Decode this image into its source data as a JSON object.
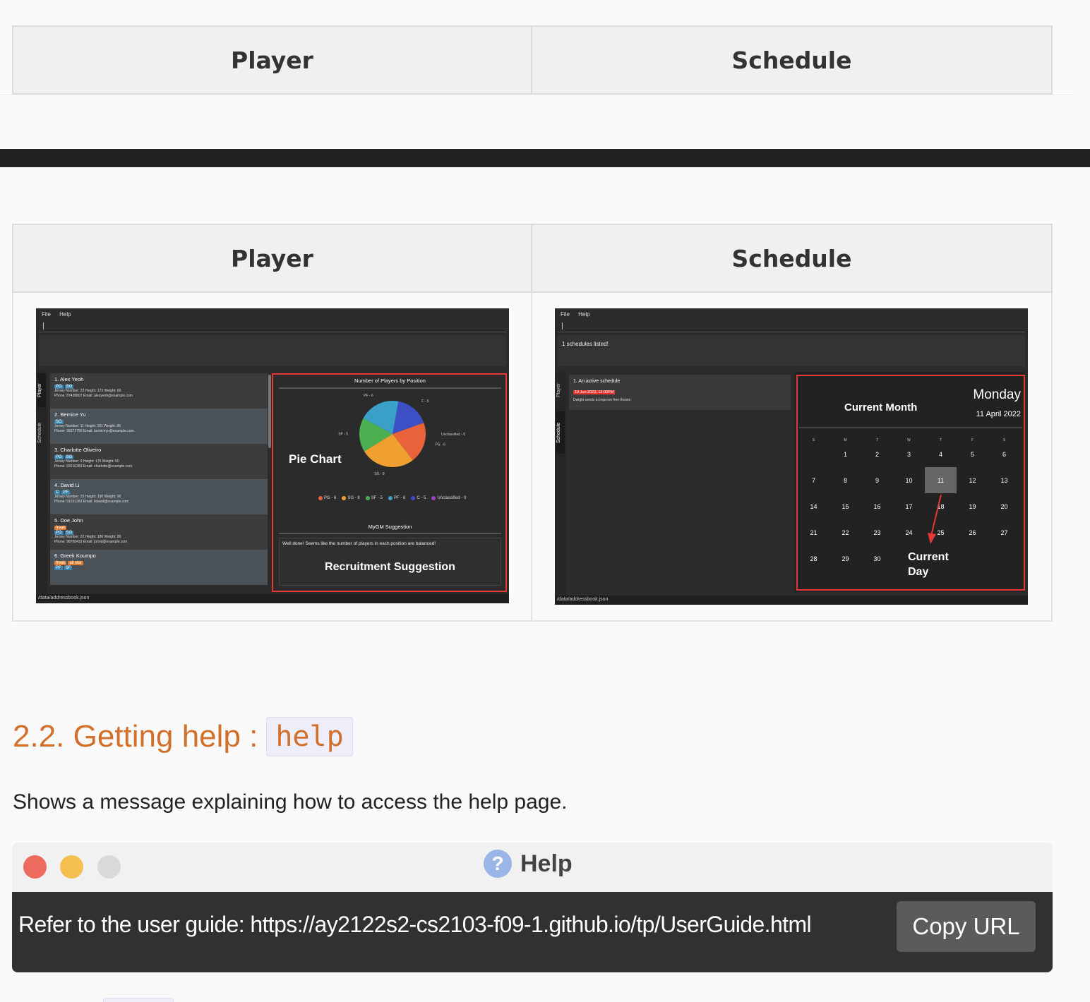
{
  "table1": {
    "col1": "Player",
    "col2": "Schedule"
  },
  "table2": {
    "col1": "Player",
    "col2": "Schedule"
  },
  "player_app": {
    "menu": [
      "File",
      "Help"
    ],
    "tabs": [
      "Player",
      "Schedule"
    ],
    "players": [
      {
        "name": "1. Alex Yeoh",
        "tags": [
          "PG",
          "SG"
        ],
        "traits": [],
        "line1": "Jersey Number: 23  Height: 172  Weight: 60",
        "line2": "Phone: 87438807  Email: alexyeoh@example.com"
      },
      {
        "name": "2. Bernice Yu",
        "tags": [
          "SG"
        ],
        "traits": [],
        "line1": "Jersey Number: 11  Height: 181  Weight: 85",
        "line2": "Phone: 99272758  Email: berniceyu@example.com"
      },
      {
        "name": "3. Charlotte Oliveiro",
        "tags": [
          "PG",
          "SG"
        ],
        "traits": [],
        "line1": "Jersey Number: 0  Height: 175  Weight: 60",
        "line2": "Phone: 93210283  Email: charlotte@example.com"
      },
      {
        "name": "4. David Li",
        "tags": [
          "C",
          "PF"
        ],
        "traits": [],
        "line1": "Jersey Number: 15  Height: 190  Weight: 90",
        "line2": "Phone: 91031282  Email: lidavid@example.com"
      },
      {
        "name": "5. Doe John",
        "tags": [
          "PG",
          "SG"
        ],
        "traits": [
          "freak"
        ],
        "line1": "Jersey Number: 22  Height: 180  Weight: 80",
        "line2": "Phone: 98765432  Email: johnd@example.com"
      },
      {
        "name": "6. Greek Koumpo",
        "tags": [
          "PF",
          "SF"
        ],
        "traits": [
          "freak",
          "all star"
        ],
        "line1": "",
        "line2": ""
      }
    ],
    "chart_title": "Number of Players by Position",
    "pie_annotation": "Pie Chart",
    "suggestion_title": "MyGM Suggestion",
    "suggestion_text": "Well done! Seems like the number of players in each position are balanced!",
    "suggestion_annotation": "Recruitment Suggestion",
    "status": "/data/addressbook.json"
  },
  "chart_data": {
    "type": "pie",
    "title": "Number of Players by Position",
    "categories": [
      "PG",
      "SG",
      "SF",
      "PF",
      "C",
      "Unclassified"
    ],
    "values": [
      6,
      8,
      5,
      6,
      5,
      0
    ],
    "slice_labels": [
      "PG - 6",
      "SG - 8",
      "SF - 5",
      "PF - 6",
      "C - 5",
      "Unclassified - 0"
    ],
    "colors": [
      "#e8623a",
      "#f0a030",
      "#4caf50",
      "#3aa0c8",
      "#3d4fc4",
      "#9c3fc4"
    ],
    "legend": "bottom"
  },
  "schedule_app": {
    "menu": [
      "File",
      "Help"
    ],
    "tabs": [
      "Player",
      "Schedule"
    ],
    "result": "1 schedules listed!",
    "schedule": {
      "title": "1.  An active schedule",
      "date": "19 Jun 2023, 12:00PM",
      "desc": "Dwight needs to improve free throws"
    },
    "day_name": "Monday",
    "date_label": "11 April 2022",
    "month_annotation": "Current Month",
    "day_annotation": [
      "Current",
      "Day"
    ],
    "weekdays": [
      "S",
      "M",
      "T",
      "W",
      "T",
      "F",
      "S"
    ],
    "days": [
      "1",
      "2",
      "3",
      "4",
      "5",
      "6",
      "7",
      "8",
      "9",
      "10",
      "11",
      "12",
      "13",
      "14",
      "15",
      "16",
      "17",
      "18",
      "19",
      "20",
      "21",
      "22",
      "23",
      "24",
      "25",
      "26",
      "27",
      "28",
      "29",
      "30"
    ],
    "today": "11",
    "status": "/data/addressbook.json"
  },
  "section": {
    "heading": "2.2. Getting help :",
    "heading_code": "help",
    "description": "Shows a message explaining how to access the help page."
  },
  "help_window": {
    "title": "Help",
    "icon": "question-icon",
    "message": "Refer to the user guide: https://ay2122s2-cs2103-f09-1.github.io/tp/UserGuide.html",
    "button": "Copy URL",
    "traffic_colors": [
      "#ec6a5e",
      "#f4bf4f",
      "#d9d9d9"
    ]
  }
}
